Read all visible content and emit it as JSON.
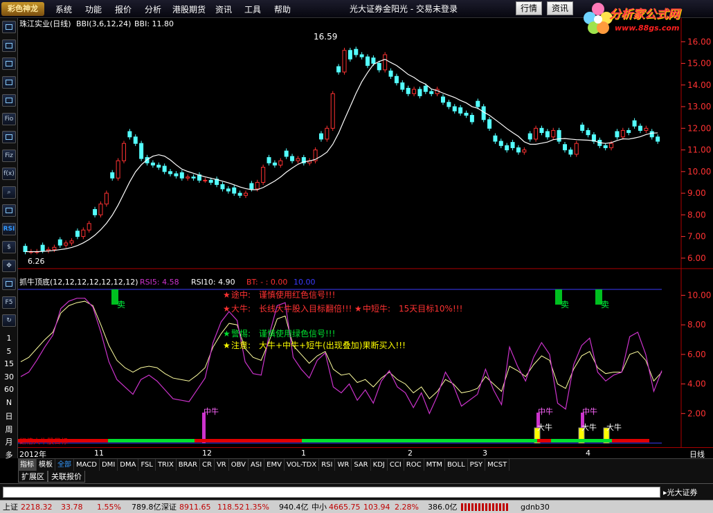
{
  "menubar": {
    "logo": "彩色神龙",
    "items": [
      "系统",
      "功能",
      "报价",
      "分析",
      "港股期货",
      "资讯",
      "工具",
      "帮助"
    ],
    "title": "光大证券金阳光 - 交易未登录",
    "buttons": [
      "行情",
      "资讯"
    ]
  },
  "brand": {
    "name": "分析家公式网",
    "url": "www.88gs.com"
  },
  "left_toolbar": {
    "tools": [
      "chart-icon",
      "kline-icon",
      "line-icon",
      "bar-icon",
      "list-icon",
      "fio-icon",
      "box-icon",
      "fiz-icon",
      "fx-icon",
      "search-icon",
      "bars-icon",
      "RSI",
      "dollar-icon",
      "move-icon",
      "grid-icon",
      "F5",
      "refresh-icon"
    ],
    "periods": [
      "1",
      "5",
      "15",
      "30",
      "60",
      "N",
      "日",
      "周",
      "月",
      "多"
    ]
  },
  "price_panel": {
    "header": {
      "stock": "珠江实业(日线)",
      "indicator": "BBI(3,6,12,24)",
      "value": "BBI: 11.80"
    },
    "yticks": [
      "16.00",
      "15.00",
      "14.00",
      "13.00",
      "12.00",
      "11.00",
      "10.00",
      "9.00",
      "8.00",
      "7.00",
      "6.00"
    ],
    "ylim": [
      5.75,
      16.3
    ],
    "annotations": {
      "high_label": "16.59",
      "low_label": "6.26"
    },
    "colors": {
      "up": "#ff3232",
      "down": "#54ffff",
      "bbi": "#ffffff",
      "axis": "#ff3232"
    }
  },
  "indicator_panel": {
    "name": "抓牛顶底(12,12,12,12,12,12,12)",
    "rsi5": "RSI5: 4.58",
    "rsi10": "RSI10: 4.90",
    "bt": "BT: - : 0.00",
    "extra": "10.00",
    "yticks": [
      "10.00",
      "8.00",
      "6.00",
      "4.00",
      "2.00"
    ],
    "ylim": [
      0,
      10.6
    ],
    "legend": [
      {
        "star": "★",
        "color": "#ff3232",
        "label": "途中:",
        "text": "谨慎使用红色信号!!!"
      },
      {
        "star": "★",
        "color": "#ff3232",
        "label": "大牛:",
        "text": "长线大牛股入目标翻倍!!!"
      },
      {
        "star": "★",
        "color": "#ff3232",
        "label": "中短牛:",
        "text": "15天目标10%!!!"
      },
      {
        "star": "★",
        "color": "#00e030",
        "label": "警惕:",
        "text": "谨慎使用绿色信号!!!"
      },
      {
        "star": "★",
        "color": "#ffff00",
        "label": "注意:",
        "text": "大牛+中牛+短牛(出现叠加)果断买入!!!"
      }
    ],
    "signals": {
      "sell": "卖",
      "mid": "中牛",
      "big": "大牛"
    },
    "bottom_label": "翻倍大牛股目标",
    "colors": {
      "rsi5": "#cc33cc",
      "rsi10": "#ffffa0",
      "sell": "#00c020"
    }
  },
  "xaxis": {
    "labels": [
      "2012年",
      "11",
      "12",
      "1",
      "2",
      "3",
      "4"
    ],
    "period": "日线"
  },
  "tabs": [
    "指标",
    "模板",
    "全部",
    "MACD",
    "DMI",
    "DMA",
    "FSL",
    "TRIX",
    "BRAR",
    "CR",
    "VR",
    "OBV",
    "ASI",
    "EMV",
    "VOL-TDX",
    "RSI",
    "WR",
    "SAR",
    "KDJ",
    "CCI",
    "ROC",
    "MTM",
    "BOLL",
    "PSY",
    "MCST"
  ],
  "subtabs": [
    "扩展区",
    "关联报价"
  ],
  "scroll_text": "▸光大证券",
  "statusbar": {
    "sh_label": "上证",
    "sh_value": "2218.32",
    "sh_chg": "33.78",
    "sh_pct": "1.55%",
    "sh_amt": "789.8亿",
    "sz_label": "深证",
    "sz_value": "8911.65",
    "sz_chg": "118.52",
    "sz_pct": "1.35%",
    "sz_amt": "940.4亿",
    "zx_label": "中小",
    "zx_value": "4665.75",
    "zx_chg": "103.94",
    "zx_pct": "2.28%",
    "zx_amt": "386.0亿",
    "user": "gdnb30"
  }
}
